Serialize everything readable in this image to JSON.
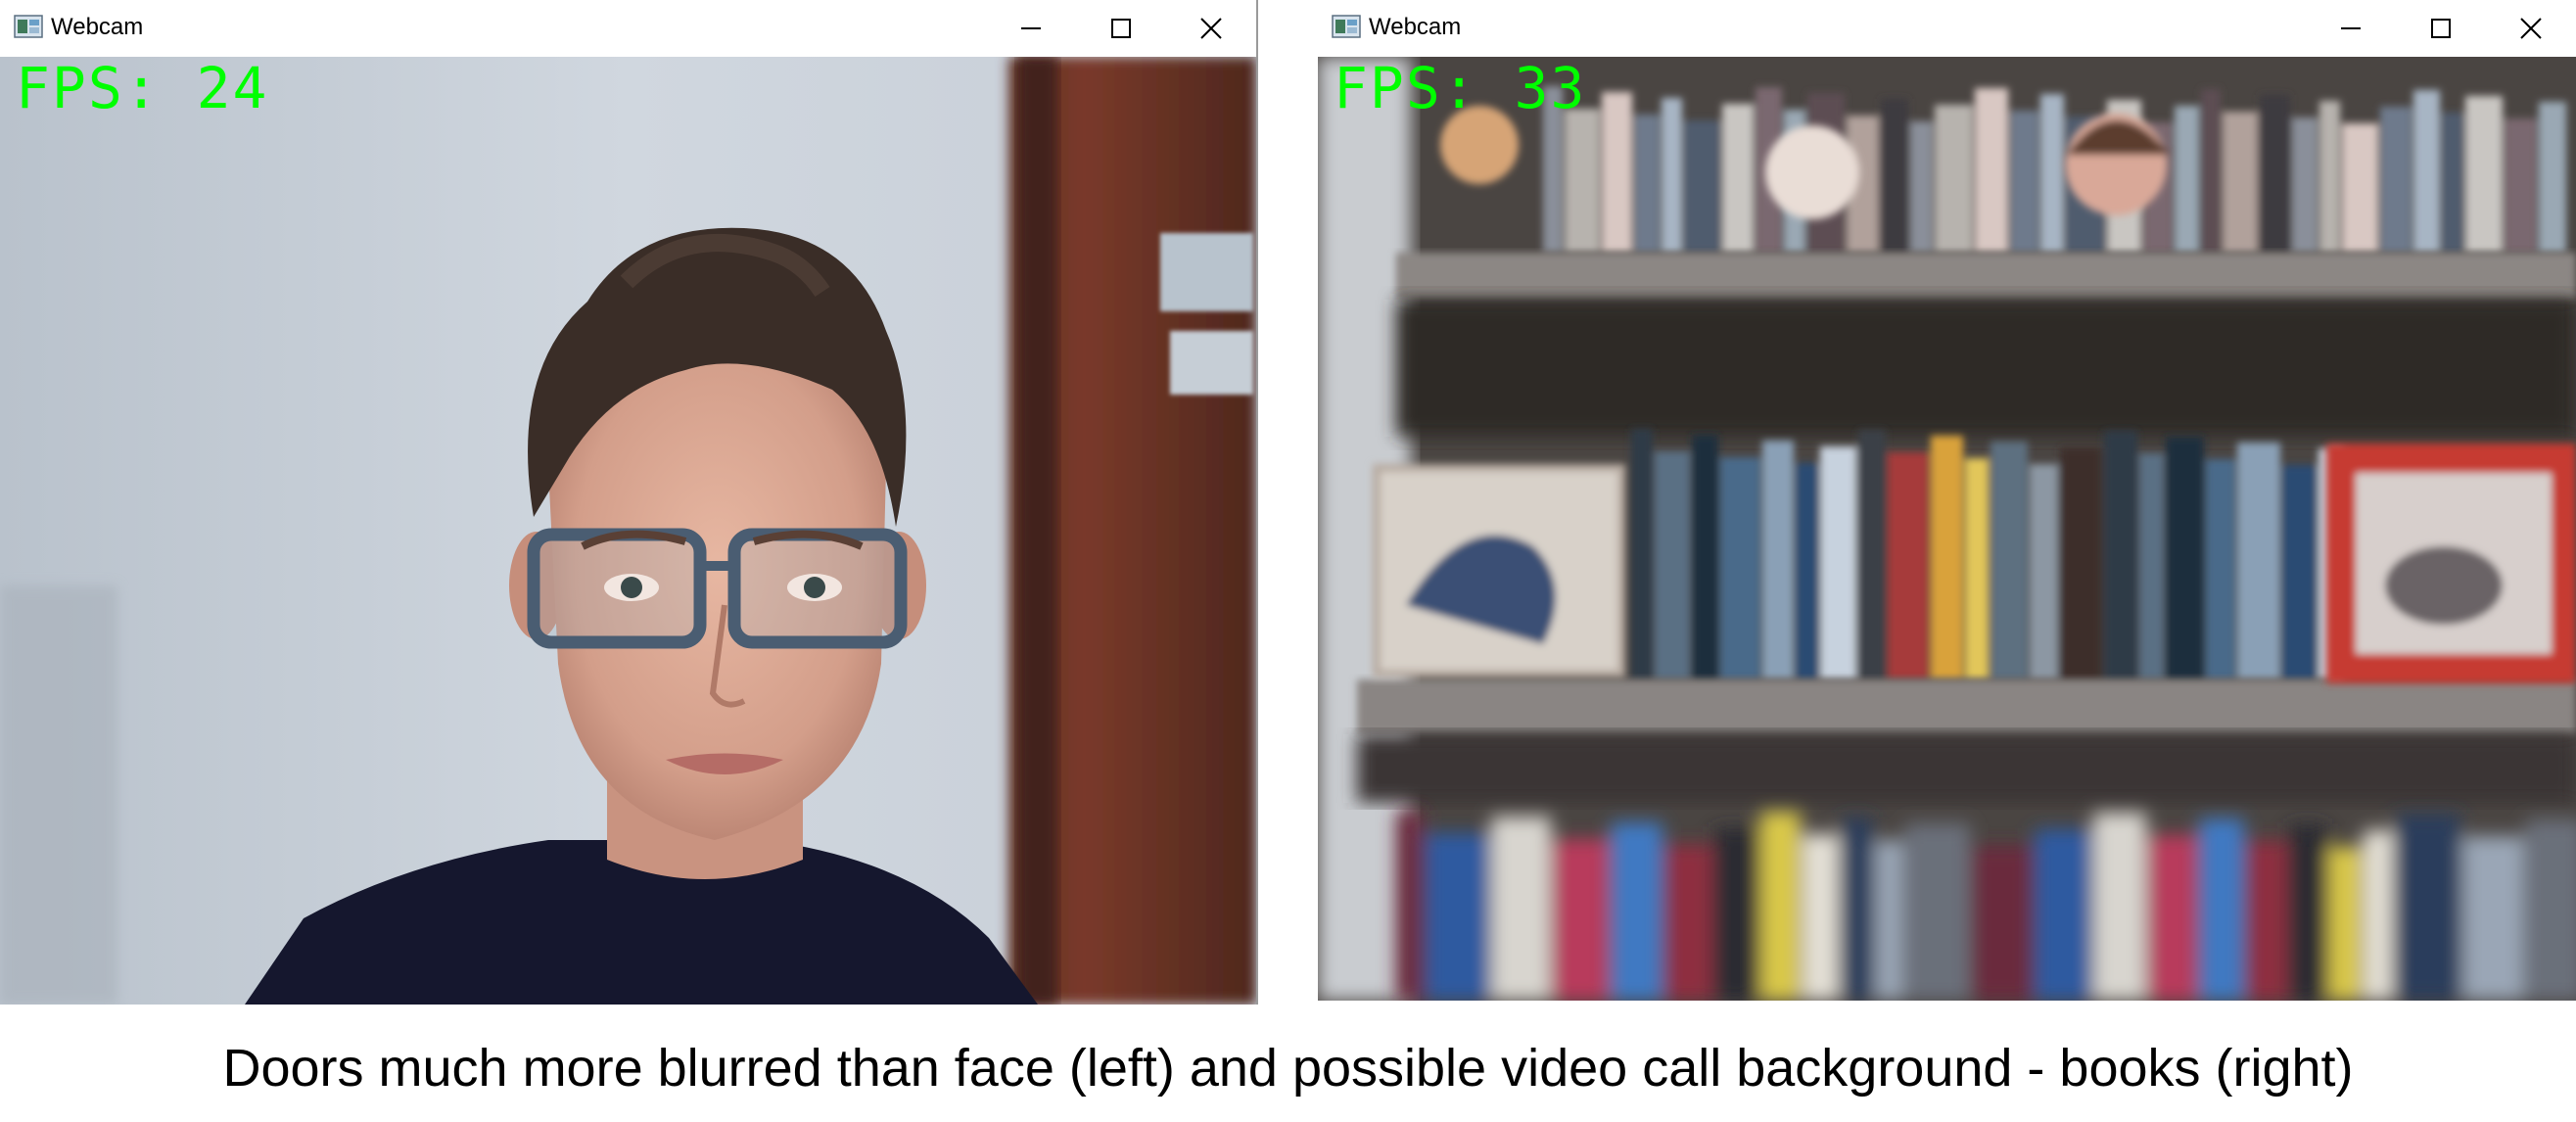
{
  "windows": [
    {
      "title": "Webcam",
      "fps_text": "FPS: 24",
      "icon": "webcam-app-icon",
      "controls": [
        "minimize-icon",
        "maximize-icon",
        "close-icon"
      ],
      "scene": "person wearing glasses in front of a light wall and a wooden door"
    },
    {
      "title": "Webcam",
      "fps_text": "FPS: 33",
      "icon": "webcam-app-icon",
      "controls": [
        "minimize-icon",
        "maximize-icon",
        "close-icon"
      ],
      "scene": "bookshelf with books and figurines"
    }
  ],
  "caption": "Doors much more blurred than face (left) and possible video call background - books (right)",
  "colors": {
    "fps_text": "#00ff00",
    "title_bar": "#ffffff",
    "caption_text": "#000000"
  }
}
